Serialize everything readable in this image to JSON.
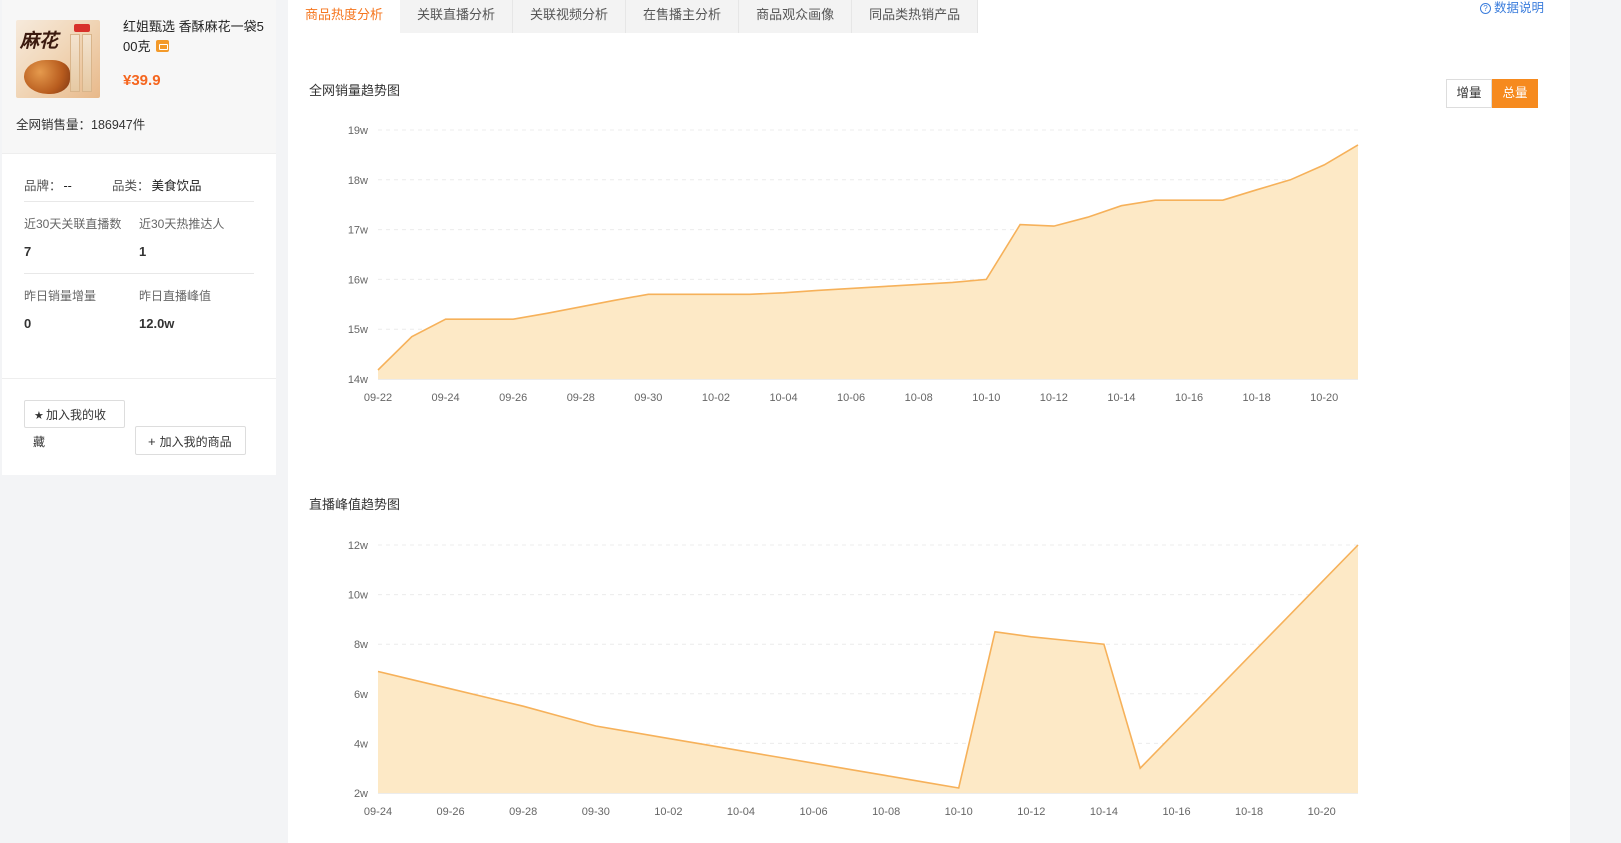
{
  "product": {
    "name": "红姐甄选 香酥麻花一袋500克",
    "price": "¥39.9",
    "sales": "全网销售量：186947件",
    "thumb_brand_text": "麻花"
  },
  "info": {
    "brand_label": "品牌：",
    "brand_value": "--",
    "category_label": "品类：",
    "category_value": "美食饮品",
    "stats": [
      {
        "label": "近30天关联直播数",
        "value": "7"
      },
      {
        "label": "近30天热推达人",
        "value": "1"
      },
      {
        "label": "昨日销量增量",
        "value": "0"
      },
      {
        "label": "昨日直播峰值",
        "value": "12.0w"
      }
    ]
  },
  "actions": {
    "favorite_label": "加入我的收",
    "favorite_tail": "藏",
    "add_label": "加入我的商品"
  },
  "tabs": [
    "商品热度分析",
    "关联直播分析",
    "关联视频分析",
    "在售播主分析",
    "商品观众画像",
    "同品类热销产品"
  ],
  "help_label": "数据说明",
  "toggle": {
    "increment": "增量",
    "total": "总量",
    "active": "总量"
  },
  "colors": {
    "accent": "#f68a1e",
    "line": "#f6b15a",
    "area": "#fde9c6",
    "link": "#3b7ddc"
  },
  "chart_data": [
    {
      "type": "area",
      "title": "全网销量趋势图",
      "x": [
        "09-22",
        "09-23",
        "09-24",
        "09-25",
        "09-26",
        "09-27",
        "09-28",
        "09-29",
        "09-30",
        "10-01",
        "10-02",
        "10-03",
        "10-04",
        "10-05",
        "10-06",
        "10-07",
        "10-08",
        "10-09",
        "10-10",
        "10-11",
        "10-12",
        "10-13",
        "10-14",
        "10-15",
        "10-16",
        "10-17",
        "10-18",
        "10-19",
        "10-20",
        "10-21"
      ],
      "x_tick_labels": [
        "09-22",
        "09-24",
        "09-26",
        "09-28",
        "09-30",
        "10-02",
        "10-04",
        "10-06",
        "10-08",
        "10-10",
        "10-12",
        "10-14",
        "10-16",
        "10-18",
        "10-20"
      ],
      "y_tick_labels": [
        "14w",
        "15w",
        "16w",
        "17w",
        "18w",
        "19w"
      ],
      "ylim": [
        140000,
        190000
      ],
      "grid": true,
      "values": [
        141800,
        148500,
        152000,
        152000,
        152000,
        153200,
        154500,
        155800,
        157000,
        157000,
        157000,
        157000,
        157300,
        157800,
        158200,
        158600,
        159000,
        159400,
        160000,
        171000,
        170700,
        172500,
        174800,
        175900,
        175900,
        175900,
        178000,
        180000,
        183000,
        187000
      ]
    },
    {
      "type": "area",
      "title": "直播峰值趋势图",
      "x": [
        "09-24",
        "09-25",
        "09-26",
        "09-27",
        "09-28",
        "09-29",
        "09-30",
        "10-01",
        "10-02",
        "10-03",
        "10-04",
        "10-05",
        "10-06",
        "10-07",
        "10-08",
        "10-09",
        "10-10",
        "10-11",
        "10-12",
        "10-13",
        "10-14",
        "10-15",
        "10-16",
        "10-17",
        "10-18",
        "10-19",
        "10-20",
        "10-21"
      ],
      "x_tick_labels": [
        "09-24",
        "09-26",
        "09-28",
        "09-30",
        "10-02",
        "10-04",
        "10-06",
        "10-08",
        "10-10",
        "10-12",
        "10-14",
        "10-16",
        "10-18",
        "10-20"
      ],
      "y_tick_labels": [
        "2w",
        "4w",
        "6w",
        "8w",
        "10w",
        "12w"
      ],
      "ylim": [
        20000,
        120000
      ],
      "grid": true,
      "values": [
        69000,
        65500,
        62000,
        58500,
        55000,
        51000,
        47000,
        44500,
        42000,
        39500,
        37000,
        34500,
        32000,
        29500,
        27000,
        24500,
        22000,
        85000,
        83000,
        81500,
        80000,
        30000,
        45000,
        60000,
        75000,
        90000,
        105000,
        120000
      ]
    }
  ]
}
